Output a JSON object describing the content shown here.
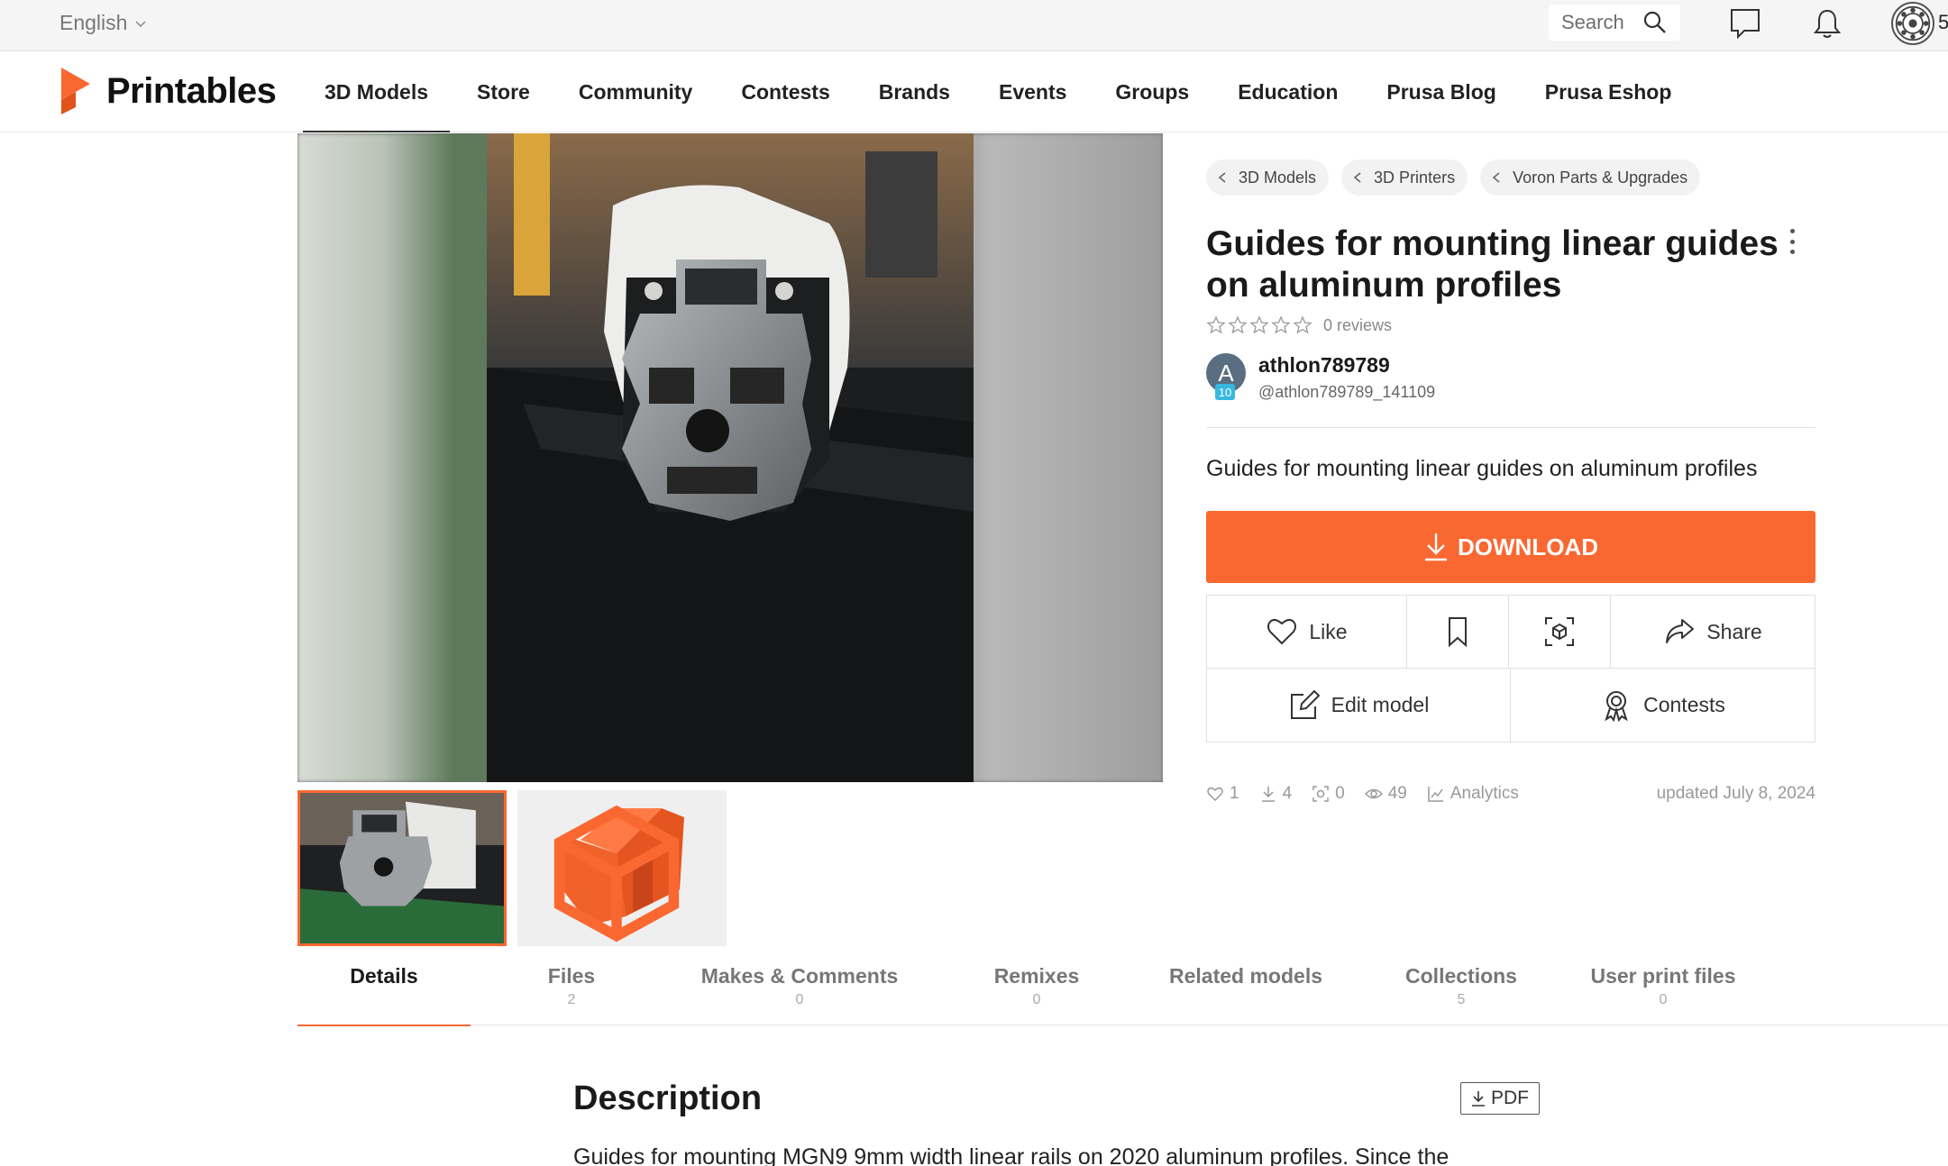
{
  "topbar": {
    "language": "English",
    "search_label": "Search",
    "avatar_tail": "5"
  },
  "nav": {
    "logo_text": "Printables",
    "items": [
      "3D Models",
      "Store",
      "Community",
      "Contests",
      "Brands",
      "Events",
      "Groups",
      "Education",
      "Prusa Blog",
      "Prusa Eshop"
    ],
    "active": "3D Models"
  },
  "breadcrumbs": [
    "3D Models",
    "3D Printers",
    "Voron Parts & Upgrades"
  ],
  "model": {
    "title": "Guides for mounting linear guides on aluminum profiles",
    "reviews": "0 reviews",
    "summary": "Guides for mounting linear guides on aluminum profiles"
  },
  "author": {
    "initial": "A",
    "level": "10",
    "name": "athlon789789",
    "handle": "@athlon789789_141109"
  },
  "actions": {
    "download": "DOWNLOAD",
    "like": "Like",
    "share": "Share",
    "edit": "Edit model",
    "contests": "Contests"
  },
  "stats": {
    "likes": "1",
    "downloads": "4",
    "makes": "0",
    "views": "49",
    "analytics": "Analytics",
    "updated": "updated July 8, 2024"
  },
  "tabs": [
    {
      "label": "Details",
      "count": ""
    },
    {
      "label": "Files",
      "count": "2"
    },
    {
      "label": "Makes & Comments",
      "count": "0"
    },
    {
      "label": "Remixes",
      "count": "0"
    },
    {
      "label": "Related models",
      "count": ""
    },
    {
      "label": "Collections",
      "count": "5"
    },
    {
      "label": "User print files",
      "count": "0"
    }
  ],
  "description": {
    "title": "Description",
    "pdf_label": "PDF",
    "text": "Guides for mounting MGN9 9mm width linear rails on 2020 aluminum profiles. Since the"
  },
  "colors": {
    "accent": "#fa6831",
    "top_bar": "#f5f5f5",
    "text": "#1a1a1a"
  },
  "icons": [
    "search-icon",
    "chat-icon",
    "bell-icon",
    "heart-icon",
    "bookmark-icon",
    "ar-cube-icon",
    "share-icon",
    "edit-icon",
    "award-icon",
    "download-icon",
    "eye-icon",
    "analytics-icon"
  ]
}
